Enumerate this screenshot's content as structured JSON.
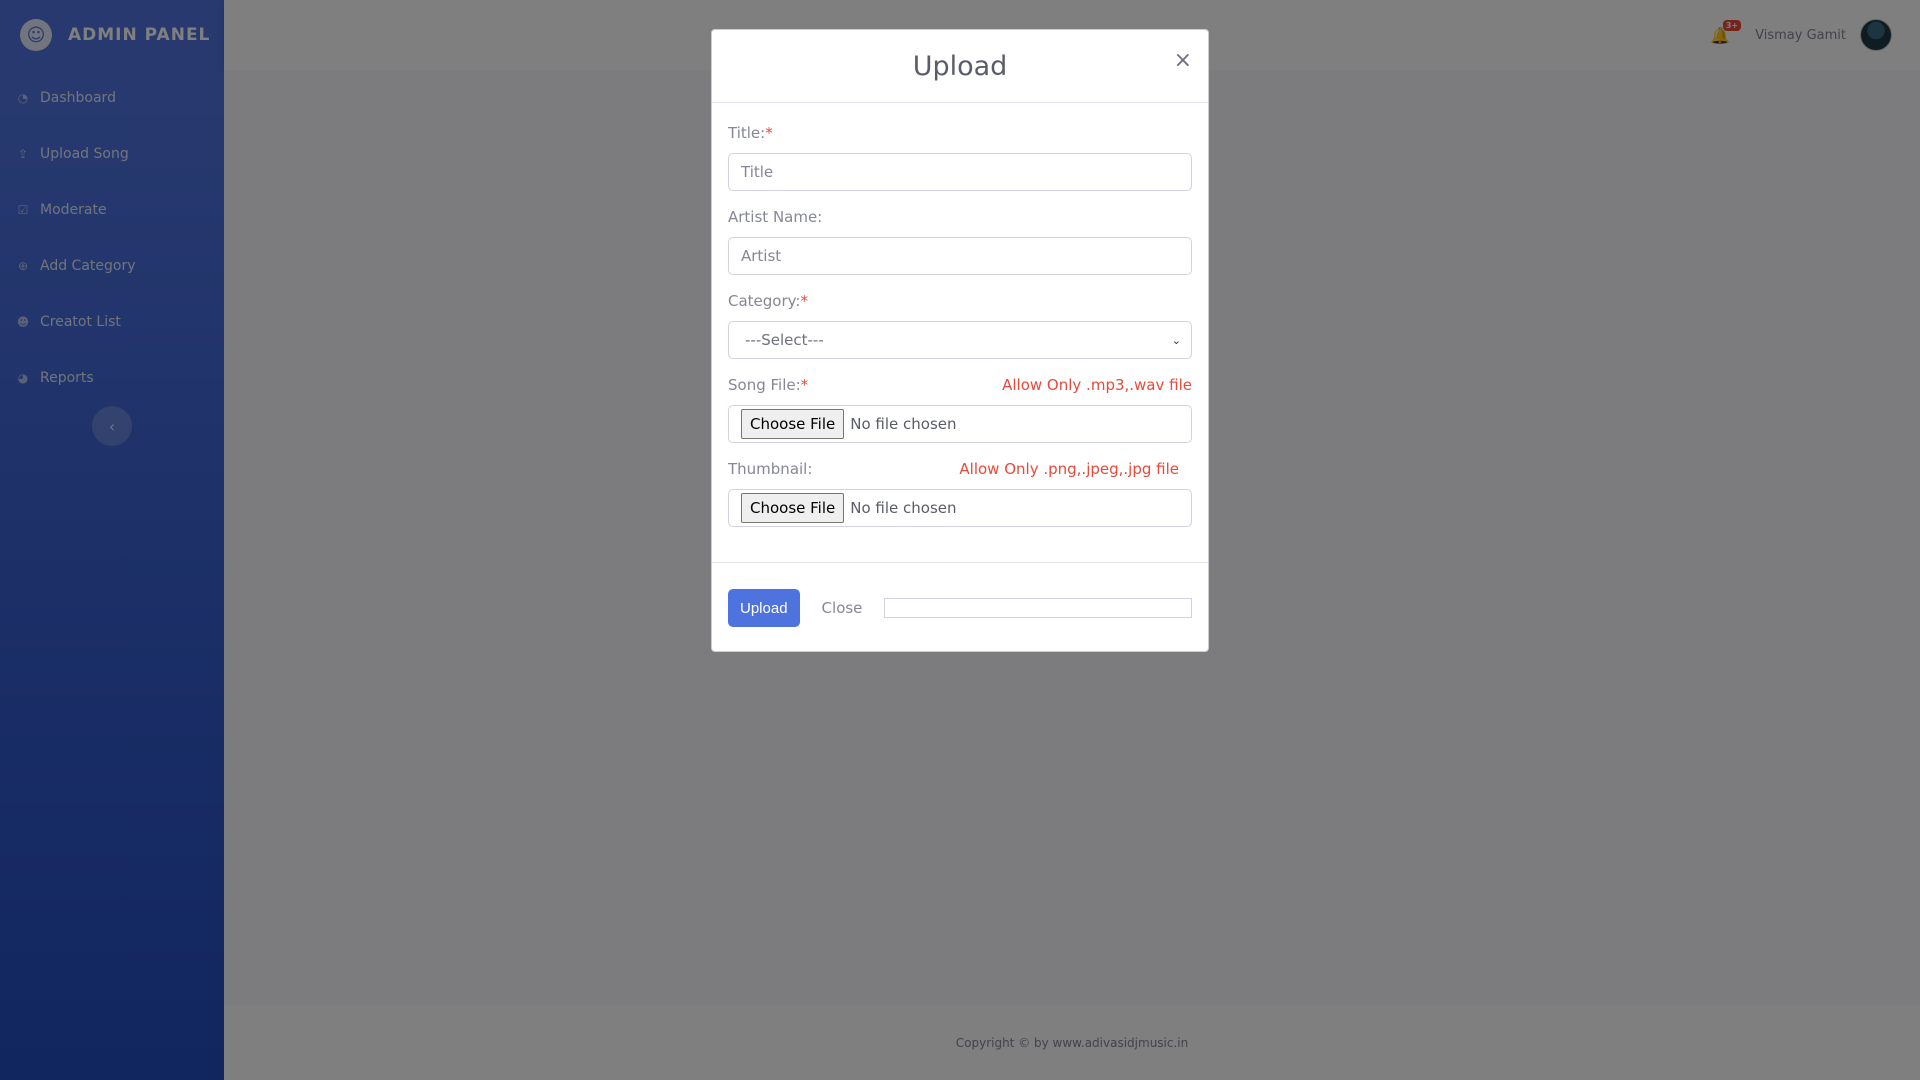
{
  "brand": {
    "name": "ADMIN PANEL"
  },
  "sidebar": {
    "items": [
      {
        "label": "Dashboard",
        "icon": "dashboard-icon"
      },
      {
        "label": "Upload Song",
        "icon": "upload-icon"
      },
      {
        "label": "Moderate",
        "icon": "check-square-icon"
      },
      {
        "label": "Add Category",
        "icon": "plus-circle-icon"
      },
      {
        "label": "Creatot List",
        "icon": "user-plus-icon"
      },
      {
        "label": "Reports",
        "icon": "chart-icon"
      }
    ]
  },
  "topbar": {
    "notification_count": "3+",
    "user_name": "Vismay Gamit"
  },
  "footer": {
    "text": "Copyright © by www.adivasidjmusic.in"
  },
  "modal": {
    "title": "Upload",
    "close_symbol": "×",
    "fields": {
      "title": {
        "label": "Title:",
        "required": "*",
        "placeholder": "Title"
      },
      "artist": {
        "label": "Artist Name:",
        "placeholder": "Artist"
      },
      "category": {
        "label": "Category:",
        "required": "*",
        "selected": "---Select---"
      },
      "song": {
        "label": "Song File:",
        "required": "*",
        "hint": "Allow Only .mp3,.wav file",
        "button": "Choose File",
        "status": "No file chosen"
      },
      "thumbnail": {
        "label": "Thumbnail:",
        "hint": "Allow Only .png,.jpeg,.jpg file",
        "button": "Choose File",
        "status": "No file chosen"
      }
    },
    "footer": {
      "upload_label": "Upload",
      "close_label": "Close",
      "progress": 0
    }
  },
  "colors": {
    "primary": "#4e73df",
    "danger": "#e74a3b",
    "overlay": "rgba(0,0,0,0.5)"
  }
}
